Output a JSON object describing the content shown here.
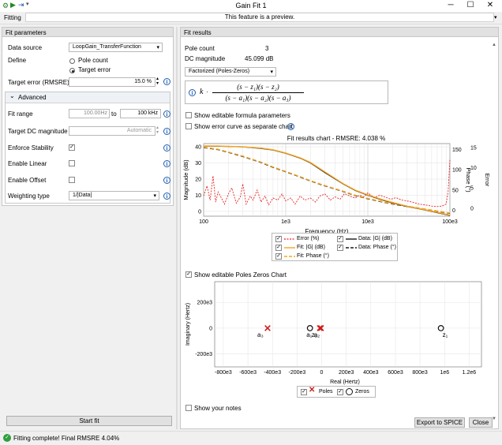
{
  "window": {
    "title": "Gain Fit 1"
  },
  "toolbar": {
    "fitting_label": "Fitting",
    "preview_notice": "This feature is a preview."
  },
  "left": {
    "header": "Fit parameters",
    "data_source_label": "Data source",
    "data_source_value": "LoopGain_TransferFunction",
    "define_label": "Define",
    "define_options": [
      "Pole count",
      "Target error"
    ],
    "define_selected": "Target error",
    "target_error_label": "Target error (RMSRE)",
    "target_error_value": "15.0 %",
    "advanced_label": "Advanced",
    "fit_range_label": "Fit range",
    "fit_range_from": "100.00Hz",
    "fit_range_to_label": "to",
    "fit_range_to": "100 kHz",
    "target_dc_label": "Target DC magnitude",
    "target_dc_value": "Automatic",
    "enforce_stability_label": "Enforce Stability",
    "enforce_stability_checked": true,
    "enable_linear_label": "Enable Linear",
    "enable_offset_label": "Enable Offset",
    "weighting_label": "Weighting type",
    "weighting_value": "1/|Data|",
    "start_fit_label": "Start fit"
  },
  "right": {
    "header": "Fit results",
    "pole_count_label": "Pole count",
    "pole_count_value": "3",
    "dc_mag_label": "DC magnitude",
    "dc_mag_value": "45.099 dB",
    "form_value": "Factorized (Poles-Zeros)",
    "formula_k": "k",
    "formula_num": "(s − z₁)(s − z₂)",
    "formula_den": "(s − a₁)(s − a₂)(s − a₃)",
    "show_editable_formula": "Show editable formula parameters",
    "show_error_curve": "Show error curve as separate chart",
    "show_editable_pz": "Show editable Poles Zeros Chart",
    "show_notes": "Show your notes",
    "export_label": "Export to SPICE",
    "close_label": "Close"
  },
  "status": {
    "message": "Fitting complete! Final RMSRE 4.04%"
  },
  "colors": {
    "fit": "#f5a623",
    "error": "#e82222",
    "data": "#1a1a1a"
  },
  "chart_data": [
    {
      "type": "line",
      "title": "Fit results chart - RMSRE: 4.038 %",
      "xlabel": "Frequency (Hz)",
      "xscale": "log",
      "xlim": [
        100,
        100000
      ],
      "x_ticks": [
        "100",
        "1e3",
        "10e3",
        "100e3"
      ],
      "ylabel_left": "Magnitude (dB)",
      "ylim_left": [
        -3,
        42
      ],
      "y_ticks_left": [
        "0",
        "10",
        "20",
        "30",
        "40"
      ],
      "ylabel_right_inner": "Phase (°)",
      "ylim_right_inner": [
        -15,
        165
      ],
      "y_ticks_right_inner": [
        "0",
        "50",
        "100",
        "150"
      ],
      "ylabel_right_outer": "Error",
      "ylim_right_outer": [
        -2,
        16
      ],
      "y_ticks_right_outer": [
        "0",
        "5",
        "10",
        "15"
      ],
      "legend": [
        "Error (%)",
        "Data: |G| (dB)",
        "Fit: |G| (dB)",
        "Data: Phase (°)",
        "Fit: Phase (°)"
      ],
      "series": [
        {
          "name": "Data: |G| (dB)",
          "axis": "mag",
          "x": [
            100,
            150,
            200,
            300,
            500,
            700,
            1000,
            1500,
            2000,
            3000,
            5000,
            7000,
            10000,
            15000,
            20000,
            30000,
            50000,
            70000,
            100000
          ],
          "values": [
            40.5,
            40.4,
            40.2,
            40.0,
            39.0,
            38.0,
            36.0,
            33.0,
            30.0,
            24.0,
            17.0,
            13.0,
            10.0,
            7.0,
            5.2,
            3.0,
            0.8,
            -0.8,
            -2.5
          ]
        },
        {
          "name": "Fit: |G| (dB)",
          "axis": "mag",
          "x": [
            100,
            150,
            200,
            300,
            500,
            700,
            1000,
            1500,
            2000,
            3000,
            5000,
            7000,
            10000,
            15000,
            20000,
            30000,
            50000,
            70000,
            100000
          ],
          "values": [
            40.6,
            40.5,
            40.3,
            40.0,
            39.2,
            38.2,
            36.2,
            33.2,
            30.3,
            24.5,
            17.2,
            13.2,
            10.2,
            7.3,
            5.5,
            3.2,
            1.0,
            -0.6,
            -2.3
          ]
        },
        {
          "name": "Data: Phase (°)",
          "axis": "phase",
          "x": [
            100,
            150,
            200,
            300,
            500,
            700,
            1000,
            1500,
            2000,
            3000,
            5000,
            7000,
            10000,
            15000,
            20000,
            30000,
            50000,
            70000,
            100000
          ],
          "values": [
            155,
            150,
            143,
            133,
            118,
            106,
            95,
            82,
            72,
            60,
            46,
            36,
            28,
            20,
            15,
            9,
            2,
            -3,
            -8
          ]
        },
        {
          "name": "Fit: Phase (°)",
          "axis": "phase",
          "x": [
            100,
            150,
            200,
            300,
            500,
            700,
            1000,
            1500,
            2000,
            3000,
            5000,
            7000,
            10000,
            15000,
            20000,
            30000,
            50000,
            70000,
            100000
          ],
          "values": [
            156,
            151,
            144,
            134,
            119,
            107,
            96,
            83,
            73,
            61,
            47,
            37,
            29,
            21,
            16,
            10,
            3,
            -2,
            -7
          ]
        },
        {
          "name": "Error (%)",
          "axis": "error",
          "x": [
            100,
            110,
            120,
            130,
            140,
            150,
            165,
            180,
            200,
            220,
            250,
            280,
            300,
            330,
            370,
            400,
            450,
            500,
            560,
            620,
            700,
            800,
            900,
            1000,
            1150,
            1300,
            1500,
            1700,
            2000,
            2300,
            2600,
            3000,
            3500,
            4000,
            4600,
            5200,
            6000,
            7000,
            8000,
            9000,
            10000,
            12000,
            14000,
            16000,
            19000,
            22000,
            26000,
            30000,
            36000,
            42000,
            50000,
            60000,
            70000,
            80000,
            90000,
            95000,
            100000
          ],
          "values": [
            3.0,
            5.5,
            2.0,
            8.0,
            1.5,
            4.0,
            2.5,
            1.0,
            3.5,
            5.0,
            1.2,
            2.8,
            6.0,
            1.0,
            3.0,
            2.0,
            4.5,
            1.5,
            3.0,
            0.8,
            2.5,
            2.0,
            3.5,
            1.8,
            2.5,
            1.0,
            3.0,
            2.0,
            2.5,
            1.5,
            3.0,
            3.5,
            2.0,
            2.8,
            2.2,
            3.6,
            3.0,
            2.5,
            3.2,
            2.8,
            3.8,
            2.6,
            3.2,
            2.8,
            2.2,
            2.6,
            2.0,
            1.8,
            1.4,
            1.0,
            0.8,
            0.5,
            0.4,
            0.5,
            1.0,
            4.0,
            12.0
          ]
        }
      ]
    },
    {
      "type": "scatter",
      "xlabel": "Real (Hertz)",
      "ylabel": "Imaginary (Hertz)",
      "xlim": [
        -870000,
        1300000
      ],
      "ylim": [
        -300000,
        360000
      ],
      "x_ticks": [
        "-800e3",
        "-600e3",
        "-400e3",
        "-200e3",
        "0",
        "200e3",
        "400e3",
        "600e3",
        "800e3",
        "1e6",
        "1.2e6"
      ],
      "y_ticks": [
        "200e3",
        "0",
        "-200e3"
      ],
      "legend": [
        "Poles",
        "Zeros"
      ],
      "series": [
        {
          "name": "Poles",
          "points": [
            {
              "label": "a₃",
              "x": -440000,
              "y": 0
            },
            {
              "label": "a₁",
              "x": -15000,
              "y": 0
            },
            {
              "label": "a₂",
              "x": -5000,
              "y": 0
            }
          ]
        },
        {
          "name": "Zeros",
          "points": [
            {
              "label": "z₂",
              "x": -95000,
              "y": 0
            },
            {
              "label": "z₁",
              "x": 970000,
              "y": 0
            }
          ]
        }
      ]
    }
  ]
}
